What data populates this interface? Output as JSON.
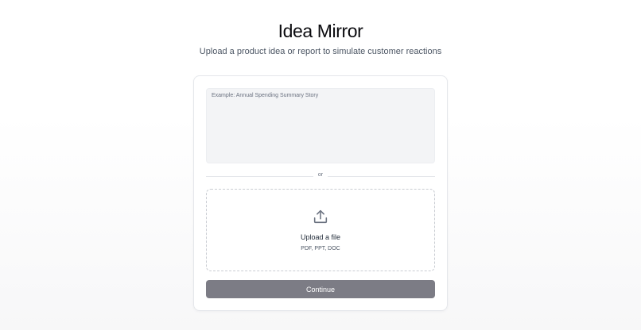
{
  "header": {
    "title": "Idea Mirror",
    "subtitle": "Upload a product idea or report to simulate customer reactions"
  },
  "form": {
    "idea_input": {
      "value": "",
      "placeholder": "Example: Annual Spending Summary Story"
    },
    "divider_text": "or",
    "upload": {
      "icon": "upload-icon",
      "label": "Upload a file",
      "formats": "PDF, PPT, DOC"
    },
    "continue_label": "Continue"
  },
  "colors": {
    "button_background": "#7c7c85",
    "button_text": "#ffffff",
    "input_background": "#f3f4f6",
    "card_border": "#e5e7eb"
  }
}
